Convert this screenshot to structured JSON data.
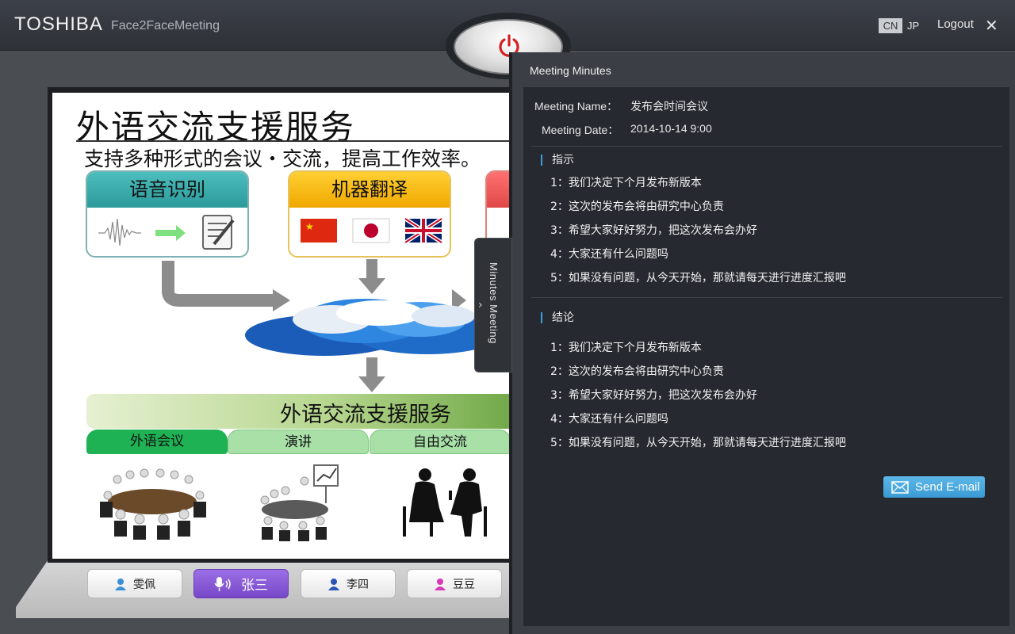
{
  "header": {
    "brand": "TOSHIBA",
    "app_name": "Face2FaceMeeting",
    "lang_cn": "CN",
    "lang_jp": "JP",
    "logout": "Logout",
    "close": "✕"
  },
  "slide": {
    "title": "外语交流支援服务",
    "subtitle": "支持多种形式的会议・交流，提高工作效率。",
    "card1": "语音识别",
    "card2": "机器翻译",
    "banner": "外语交流支援服务",
    "tabs": [
      "外语会议",
      "演讲",
      "自由交流"
    ]
  },
  "participants": [
    {
      "name": "雯佩",
      "icon": "user-icon",
      "color": "#3a8fd6"
    },
    {
      "name": "张三",
      "icon": "microphone-icon",
      "active": true
    },
    {
      "name": "李四",
      "icon": "user-icon",
      "color": "#2a56b8"
    },
    {
      "name": "豆豆",
      "icon": "user-icon",
      "color": "#d63ab8"
    }
  ],
  "minutes_tab": "Minutes Meeting",
  "minutes": {
    "title": "Meeting Minutes",
    "name_label": "Meeting Name：",
    "name_value": "发布会时间会议",
    "date_label": "Meeting Date：",
    "date_value": "2014-10-14 9:00",
    "sections": [
      {
        "heading": "指示",
        "items": [
          "1：我们决定下个月发布新版本",
          "2：这次的发布会将由研究中心负责",
          "3：希望大家好好努力，把这次发布会办好",
          "4：大家还有什么问题吗",
          "5：如果没有问题，从今天开始，那就请每天进行进度汇报吧"
        ]
      },
      {
        "heading": "结论",
        "items": [
          "1：我们决定下个月发布新版本",
          "2：这次的发布会将由研究中心负责",
          "3：希望大家好好努力，把这次发布会办好",
          "4：大家还有什么问题吗",
          "5：如果没有问题，从今天开始，那就请每天进行进度汇报吧"
        ]
      }
    ],
    "send_email": "Send E-mail"
  },
  "colors": {
    "accent": "#3aa0e0",
    "power": "#d42020",
    "active_participant": "#7748c7"
  }
}
